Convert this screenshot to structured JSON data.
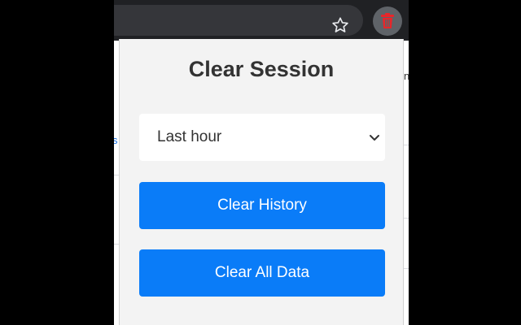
{
  "popup": {
    "title": "Clear Session",
    "time_range": {
      "selected": "Last hour"
    },
    "buttons": {
      "clear_history": "Clear History",
      "clear_all": "Clear All Data"
    }
  },
  "toolbar": {
    "bookmark_icon": "star-outline-icon",
    "extension_icon": "trash-icon"
  },
  "background": {
    "left_fragment": "s",
    "right_fragment": "n"
  },
  "colors": {
    "accent": "#0a7cf8",
    "extension_icon": "#e8262a",
    "popup_bg": "#f3f3f3"
  }
}
